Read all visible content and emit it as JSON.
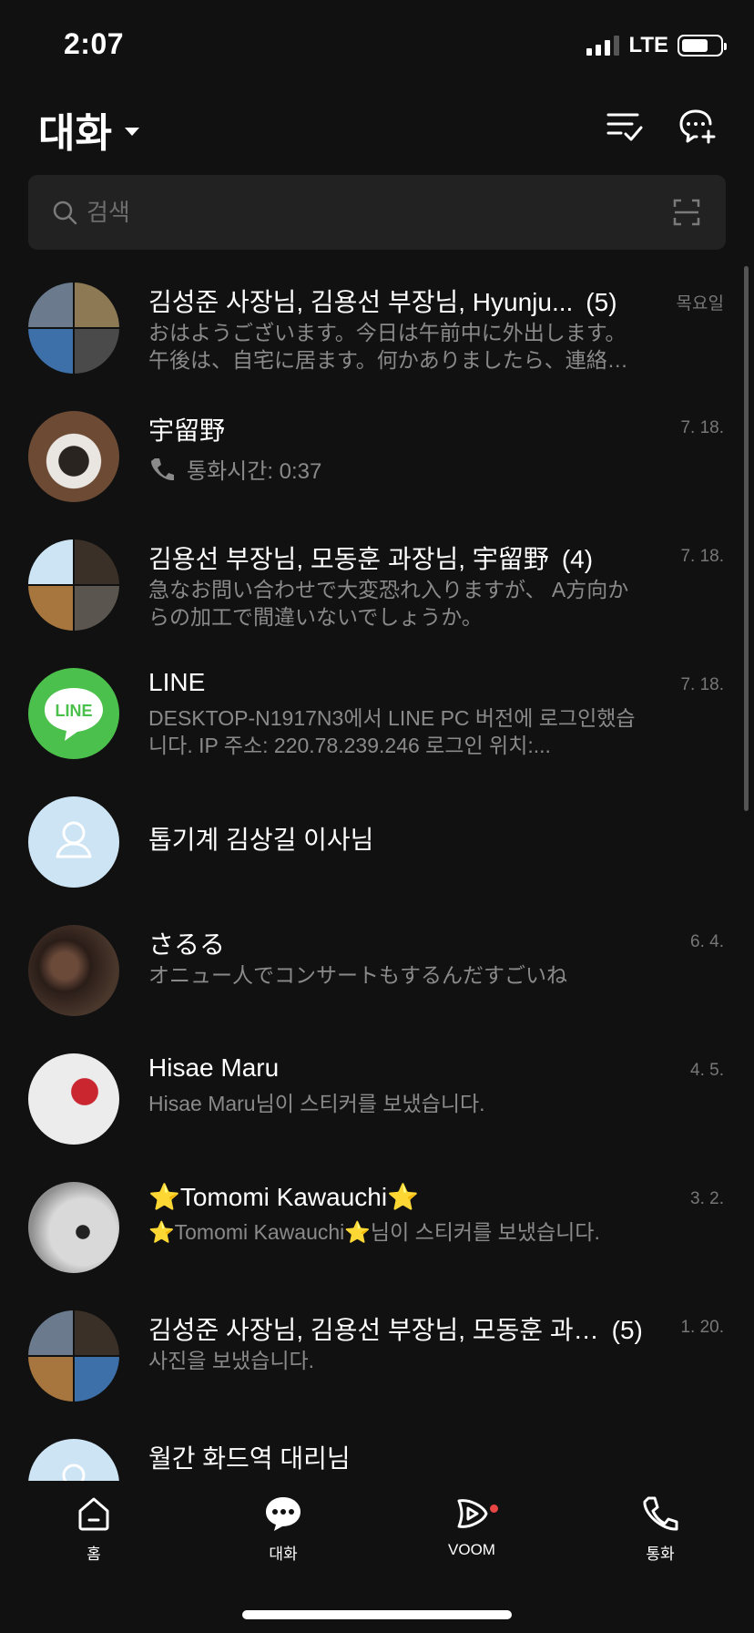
{
  "status_bar": {
    "time": "2:07",
    "network": "LTE",
    "battery_level": 0.7
  },
  "header": {
    "title": "대화",
    "icons": [
      "edit-list-icon",
      "new-chat-icon"
    ]
  },
  "search": {
    "placeholder": "검색",
    "value": ""
  },
  "chats": [
    {
      "name": "김성준 사장님, 김용선 부장님, Hyunju...",
      "count": "(5)",
      "message": "おはようございます。今日は午前中に外出します。午後は、自宅に居ます。何かありましたら、連絡ねが…",
      "date": "목요일",
      "avatar_colors": [
        "#6b7a8c",
        "#8d7a55",
        "#3d6fa8",
        "#4a4a4a"
      ]
    },
    {
      "name": "宇留野",
      "call_text": "통화시간: 0:37",
      "date": "7. 18.",
      "avatar_colors": [
        "#5a3e2b"
      ]
    },
    {
      "name": "김용선 부장님, 모동훈 과장님, 宇留野",
      "count": "(4)",
      "message": "急なお問い合わせで大変恐れ入りますが、 A方向からの加工で間違いないでしょうか。",
      "date": "7. 18.",
      "avatar_colors": [
        "#cde4f4",
        "#3b3027",
        "#a6763e",
        "#5a564f"
      ]
    },
    {
      "name": "LINE",
      "message": "DESKTOP-N1917N3에서 LINE PC 버전에 로그인했습니다. IP 주소: 220.78.239.246 로그인 위치:...",
      "date": "7. 18.",
      "avatar_colors": [
        "#4cc04c"
      ],
      "logo_text": "LINE"
    },
    {
      "name": "톱기계 김상길 이사님",
      "avatar_colors": [
        "#cde4f4"
      ]
    },
    {
      "name": "さるる",
      "message": "オニュー人でコンサートもするんだすごいね",
      "date": "6. 4.",
      "avatar_colors": [
        "#3a2a22"
      ]
    },
    {
      "name": "Hisae Maru",
      "message": "Hisae Maru님이 스티커를 보냈습니다.",
      "date": "4. 5.",
      "avatar_colors": [
        "#e8e8e8"
      ]
    },
    {
      "name": "⭐Tomomi Kawauchi⭐",
      "message": "⭐Tomomi Kawauchi⭐님이 스티커를 보냈습니다.",
      "date": "3. 2.",
      "avatar_colors": [
        "#bdbdbd"
      ]
    },
    {
      "name": "김성준 사장님, 김용선 부장님, 모동훈 과…",
      "count": "(5)",
      "message": "사진을 보냈습니다.",
      "date": "1. 20.",
      "avatar_colors": [
        "#6b7a8c",
        "#3b3027",
        "#a6763e",
        "#3d6fa8"
      ]
    },
    {
      "name": "월간 화드역 대리님",
      "avatar_colors": [
        "#cde4f4"
      ]
    }
  ],
  "bottom_nav": {
    "home": "홈",
    "chat": "대화",
    "voom": "VOOM",
    "call": "통화"
  }
}
